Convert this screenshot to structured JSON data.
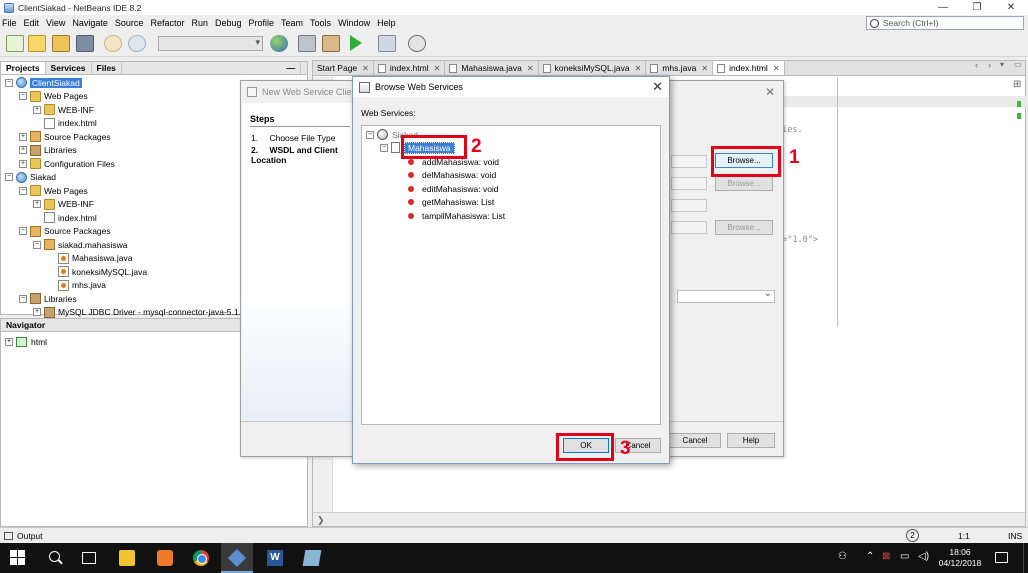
{
  "window": {
    "title": "ClientSiakad - NetBeans IDE 8.2"
  },
  "window_controls": {
    "minimize": "—",
    "maximize": "❐",
    "close": "✕"
  },
  "menu": [
    "File",
    "Edit",
    "View",
    "Navigate",
    "Source",
    "Refactor",
    "Run",
    "Debug",
    "Profile",
    "Team",
    "Tools",
    "Window",
    "Help"
  ],
  "search": {
    "placeholder": "Search (Ctrl+I)"
  },
  "projects_panel": {
    "tabs": [
      "Projects",
      "Services",
      "Files"
    ],
    "tree": [
      {
        "label": "ClientSiakad",
        "level": 0,
        "icon": "project-icon",
        "expander": "−",
        "selected": true
      },
      {
        "label": "Web Pages",
        "level": 1,
        "icon": "folder-icon",
        "expander": "−"
      },
      {
        "label": "WEB-INF",
        "level": 2,
        "icon": "folder-icon",
        "expander": "+"
      },
      {
        "label": "index.html",
        "level": 2,
        "icon": "file-icon",
        "expander": ""
      },
      {
        "label": "Source Packages",
        "level": 1,
        "icon": "package-icon",
        "expander": "+"
      },
      {
        "label": "Libraries",
        "level": 1,
        "icon": "library-icon",
        "expander": "+"
      },
      {
        "label": "Configuration Files",
        "level": 1,
        "icon": "folder-icon",
        "expander": "+"
      },
      {
        "label": "Siakad",
        "level": 0,
        "icon": "project-icon",
        "expander": "−"
      },
      {
        "label": "Web Pages",
        "level": 1,
        "icon": "folder-icon",
        "expander": "−"
      },
      {
        "label": "WEB-INF",
        "level": 2,
        "icon": "folder-icon",
        "expander": "+"
      },
      {
        "label": "index.html",
        "level": 2,
        "icon": "file-icon",
        "expander": ""
      },
      {
        "label": "Source Packages",
        "level": 1,
        "icon": "package-icon",
        "expander": "−"
      },
      {
        "label": "siakad.mahasiswa",
        "level": 2,
        "icon": "package-icon",
        "expander": "−"
      },
      {
        "label": "Mahasiswa.java",
        "level": 3,
        "icon": "java-file-icon",
        "expander": ""
      },
      {
        "label": "koneksiMySQL.java",
        "level": 3,
        "icon": "java-file-icon",
        "expander": ""
      },
      {
        "label": "mhs.java",
        "level": 3,
        "icon": "java-file-icon",
        "expander": ""
      },
      {
        "label": "Libraries",
        "level": 1,
        "icon": "library-icon",
        "expander": "−"
      },
      {
        "label": "MySQL JDBC Driver - mysql-connector-java-5.1.2",
        "level": 2,
        "icon": "library-icon",
        "expander": "+"
      }
    ]
  },
  "navigator": {
    "title": "Navigator",
    "items": [
      {
        "label": "html"
      }
    ]
  },
  "editor": {
    "tabs": [
      "Start Page",
      "index.html",
      "Mahasiswa.java",
      "koneksiMySQL.java",
      "mhs.java",
      "index.html"
    ],
    "close_glyph": "✕",
    "code_fragments": [
      "cies.",
      "n=\"1.0\">"
    ]
  },
  "background_dialog": {
    "title": "New Web Service Client",
    "steps_heading": "Steps",
    "steps": [
      {
        "num": "1.",
        "label": "Choose File Type"
      },
      {
        "num": "2.",
        "label": "WSDL and Client Location"
      }
    ],
    "browse_label": "Browse...",
    "cancel_label": "Cancel",
    "help_label": "Help"
  },
  "browse_dialog": {
    "title": "Browse Web Services",
    "label": "Web Services:",
    "root": "Siakad",
    "service": "Mahasiswa",
    "operations": [
      "addMahasiswa: void",
      "delMahasiswa: void",
      "editMahasiswa: void",
      "getMahasiswa: List",
      "tampilMahasiswa: List"
    ],
    "ok_label": "OK",
    "cancel_label": "Cancel"
  },
  "annotations": [
    "1",
    "2",
    "3"
  ],
  "status_bar": {
    "output_label": "Output",
    "position": "1:1",
    "mode": "INS"
  },
  "taskbar": {
    "time": "18:06",
    "date": "04/12/2018",
    "word_letter": "W"
  },
  "colors": {
    "annotation": "#e3001b",
    "selection": "#3a80d6"
  }
}
